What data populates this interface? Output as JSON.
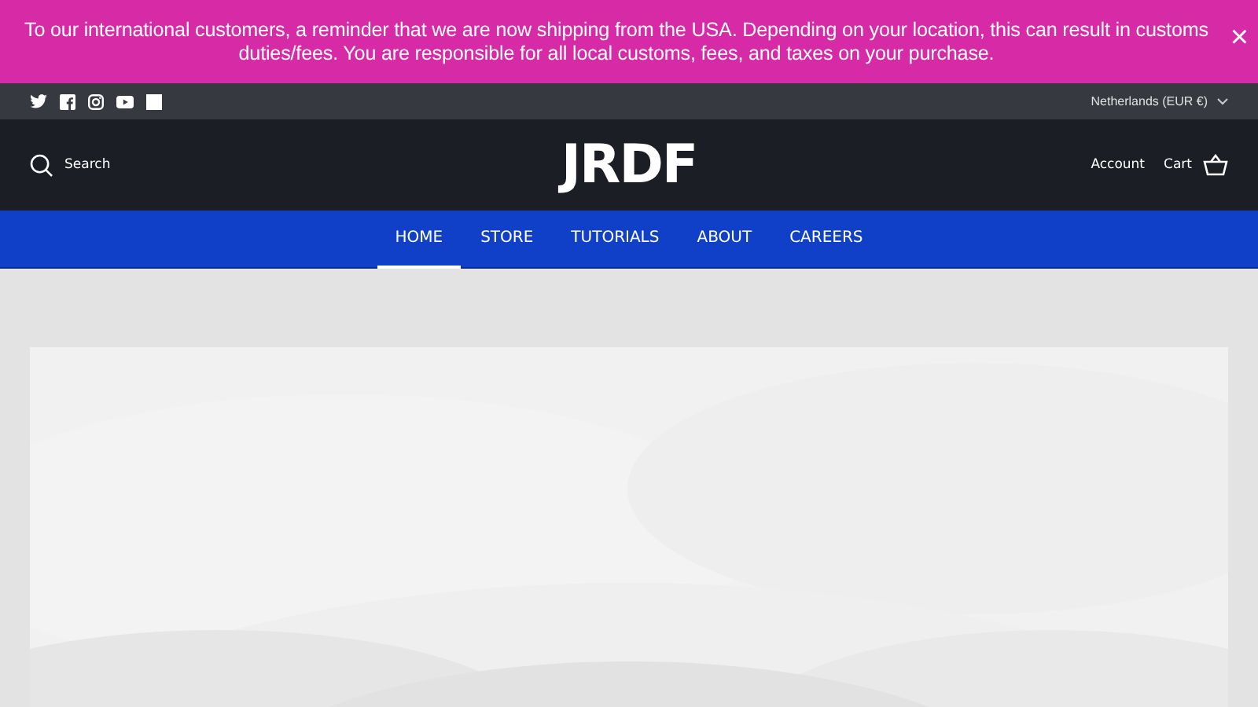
{
  "announcement": {
    "text": "To our international customers, a reminder that we are now shipping from the USA. Depending on your location, this can result in customs duties/fees. You are responsible for all local customs, fees, and taxes on your purchase.",
    "close": "×"
  },
  "topbar": {
    "social": [
      {
        "kind": "twitter"
      },
      {
        "kind": "facebook"
      },
      {
        "kind": "instagram"
      },
      {
        "kind": "youtube"
      },
      {
        "kind": "square"
      }
    ],
    "currency": "Netherlands (EUR €)"
  },
  "header": {
    "search": "Search",
    "logo": "JRDF",
    "account": "Account",
    "cart": "Cart"
  },
  "nav": [
    {
      "label": "HOME",
      "selected": true
    },
    {
      "label": "STORE",
      "selected": false
    },
    {
      "label": "TUTORIALS",
      "selected": false
    },
    {
      "label": "ABOUT",
      "selected": false
    },
    {
      "label": "CAREERS",
      "selected": false
    }
  ]
}
